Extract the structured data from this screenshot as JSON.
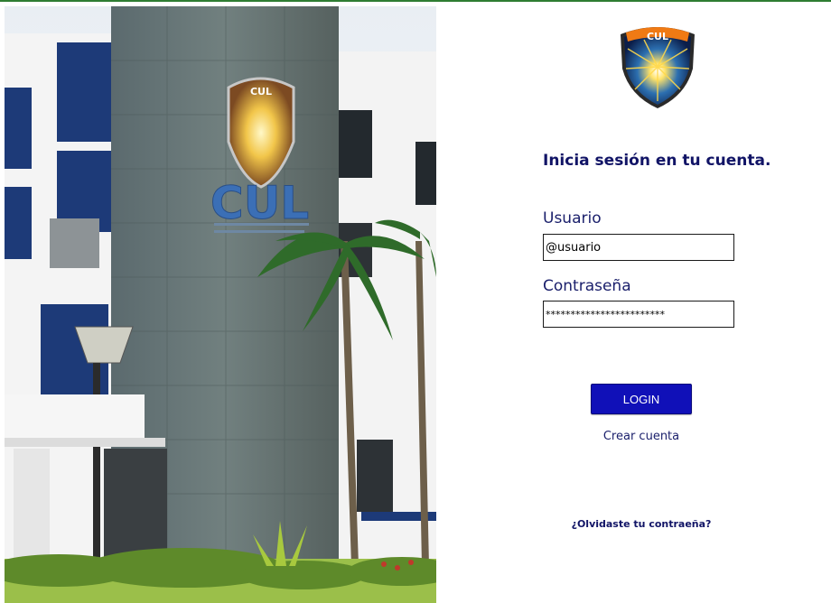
{
  "logo": {
    "text": "CUL"
  },
  "building_sign": {
    "text": "CUL"
  },
  "login": {
    "title": "Inicia sesión en tu cuenta.",
    "username_label": "Usuario",
    "username_value": "@usuario",
    "password_label": "Contraseña",
    "password_value": "************************",
    "login_button": "LOGIN",
    "create_account": "Crear cuenta",
    "forgot_password": "¿Olvidaste tu contraeña?"
  },
  "colors": {
    "accent": "#111466",
    "button": "#1010b8",
    "top_line": "#2e7d32"
  }
}
